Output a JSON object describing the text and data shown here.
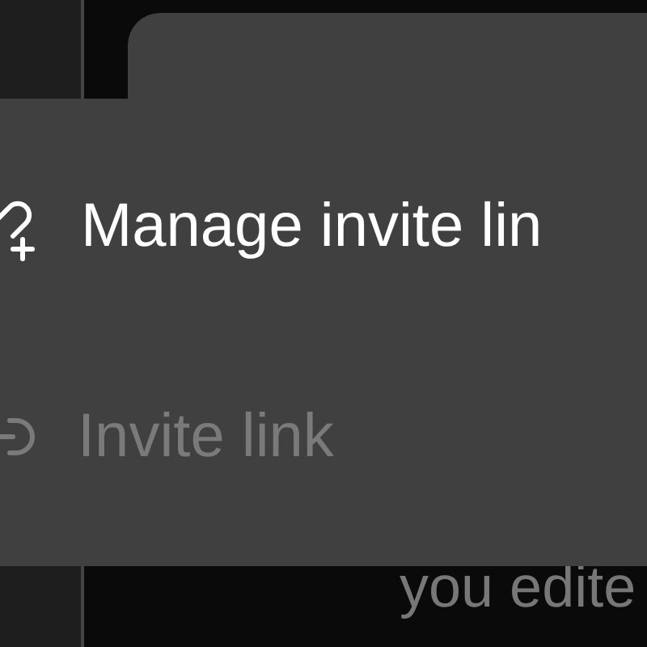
{
  "menu": {
    "items": [
      {
        "kind": "link-add",
        "label": "Manage invite lin",
        "disabled": false
      },
      {
        "kind": "enter",
        "label": "Invite link",
        "disabled": true
      }
    ]
  },
  "background_text": "you edite"
}
